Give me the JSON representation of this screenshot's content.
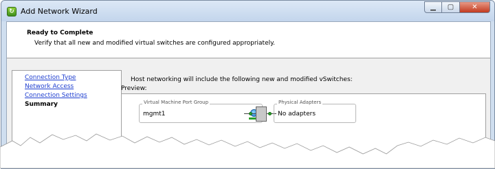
{
  "window": {
    "title": "Add Network Wizard",
    "app_icon": "vsphere-wizard-icon",
    "controls": {
      "minimize_icon": "minimize-icon",
      "maximize_icon": "maximize-icon",
      "close_icon": "close-icon"
    }
  },
  "header": {
    "title": "Ready to Complete",
    "subtitle": "Verify that all new and modified virtual switches are configured appropriately."
  },
  "nav": {
    "items": [
      {
        "label": "Connection Type",
        "state": "link"
      },
      {
        "label": "Network Access",
        "state": "link"
      },
      {
        "label": "Connection Settings",
        "state": "link"
      },
      {
        "label": "Summary",
        "state": "current"
      }
    ]
  },
  "main": {
    "intro": "Host networking will include the following new and modified vSwitches:",
    "preview_label": "Preview:",
    "port_group": {
      "legend": "Virtual Machine Port Group",
      "name": "mgmt1",
      "icon": "virtual-machine-icon"
    },
    "physical_adapters": {
      "legend": "Physical Adapters",
      "value": "No adapters"
    }
  },
  "colors": {
    "link": "#1f3fd0",
    "title_bar": "#cfdeef",
    "connector": "#2aa02a"
  }
}
